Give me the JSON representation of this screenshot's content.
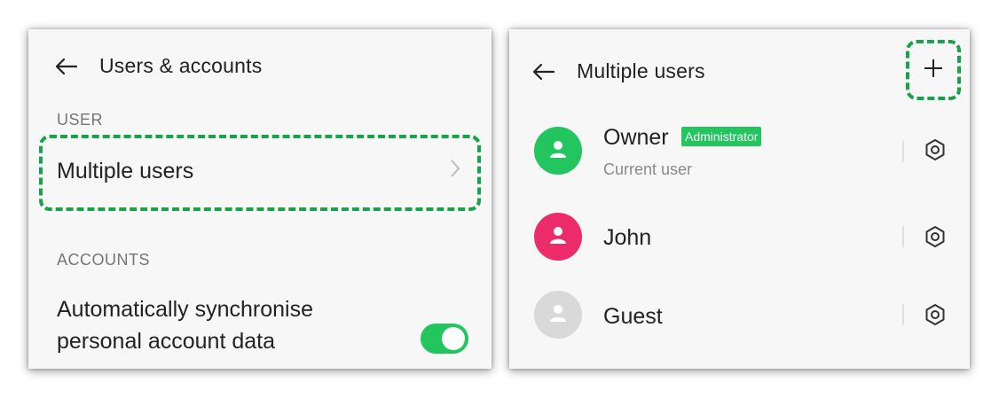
{
  "left": {
    "title": "Users & accounts",
    "user_section": "USER",
    "multiple_users_label": "Multiple users",
    "accounts_section": "ACCOUNTS",
    "sync_line1": "Automatically synchronise",
    "sync_line2": "personal account data",
    "sync_enabled": true
  },
  "right": {
    "title": "Multiple users",
    "users": [
      {
        "name": "Owner",
        "badge": "Administrator",
        "subtitle": "Current user",
        "avatar_color": "#22c55e"
      },
      {
        "name": "John",
        "avatar_color": "#ec2c6a"
      },
      {
        "name": "Guest",
        "avatar_color": "#d9d9d9"
      }
    ]
  },
  "colors": {
    "highlight": "#16a34a",
    "toggle_on": "#22c55e",
    "icons": {
      "back": "back-arrow-icon",
      "chevron": "chevron-right-icon",
      "plus": "plus-icon",
      "gear": "gear-icon",
      "avatar": "person-icon"
    }
  }
}
